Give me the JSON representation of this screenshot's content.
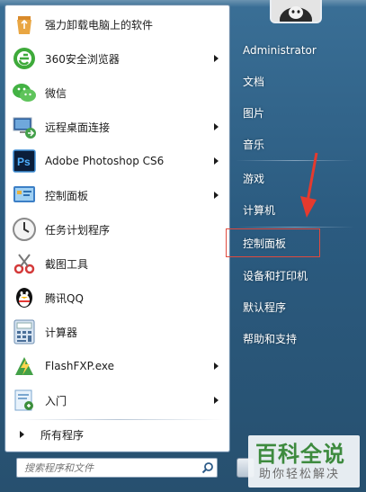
{
  "left_list": [
    {
      "label": "强力卸载电脑上的软件",
      "icon": "recycle-icon",
      "has_arrow": false
    },
    {
      "label": "360安全浏览器",
      "icon": "browser-360-icon",
      "has_arrow": true
    },
    {
      "label": "微信",
      "icon": "wechat-icon",
      "has_arrow": false
    },
    {
      "label": "远程桌面连接",
      "icon": "remote-desktop-icon",
      "has_arrow": true
    },
    {
      "label": "Adobe Photoshop CS6",
      "icon": "photoshop-icon",
      "has_arrow": true
    },
    {
      "label": "控制面板",
      "icon": "control-panel-icon",
      "has_arrow": true
    },
    {
      "label": "任务计划程序",
      "icon": "clock-icon",
      "has_arrow": false
    },
    {
      "label": "截图工具",
      "icon": "scissors-icon",
      "has_arrow": false
    },
    {
      "label": "腾讯QQ",
      "icon": "qq-penguin-icon",
      "has_arrow": false
    },
    {
      "label": "计算器",
      "icon": "calculator-icon",
      "has_arrow": false
    },
    {
      "label": "FlashFXP.exe",
      "icon": "flashfxp-icon",
      "has_arrow": true
    },
    {
      "label": "入门",
      "icon": "getting-started-icon",
      "has_arrow": true
    }
  ],
  "all_programs": "所有程序",
  "search": {
    "placeholder": "搜索程序和文件"
  },
  "right_list": {
    "user": "Administrator",
    "documents": "文档",
    "pictures": "图片",
    "music": "音乐",
    "games": "游戏",
    "computer": "计算机",
    "control_panel": "控制面板",
    "devices": "设备和打印机",
    "defaults": "默认程序",
    "help": "帮助和支持"
  },
  "watermark": {
    "title": "百科全说",
    "subtitle": "助你轻松解决"
  },
  "colors": {
    "accent_red": "#e04a3f",
    "watermark_green": "#3d8a3e"
  }
}
